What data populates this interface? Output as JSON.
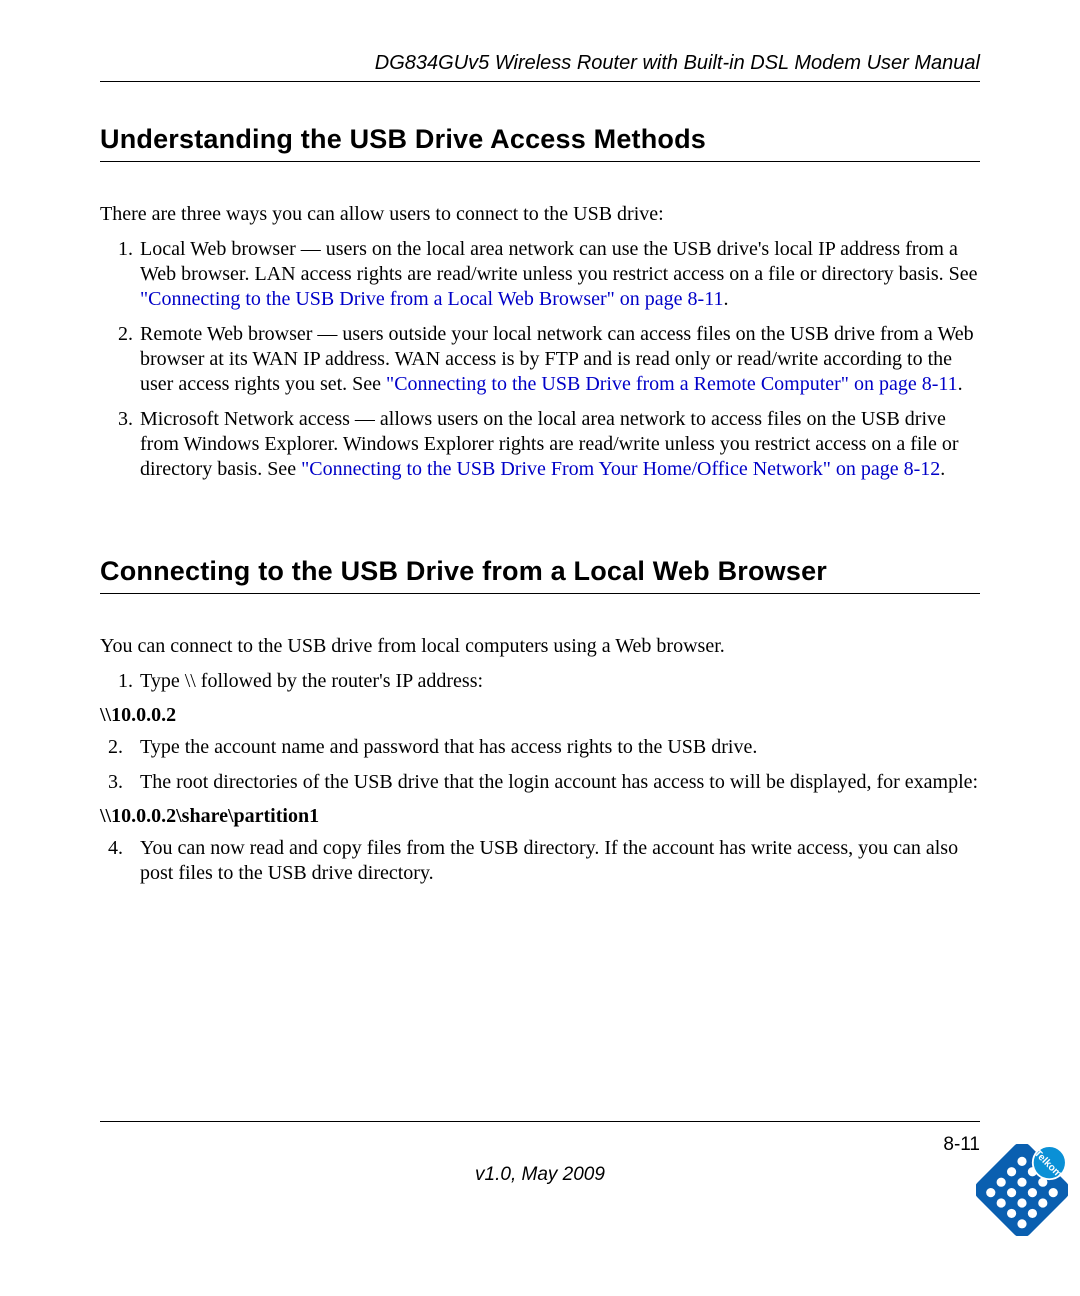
{
  "header": {
    "running_title": "DG834GUv5 Wireless Router with Built-in DSL Modem User Manual"
  },
  "section1": {
    "title": "Understanding the USB Drive Access Methods",
    "intro": "There are three ways you can allow users to connect to the USB drive:",
    "item1_a": "Local Web browser — users on the local area network can use the USB drive's local IP address from a Web browser. LAN access rights are read/write unless you restrict access on a file or directory basis. See ",
    "item1_link": "\"Connecting to the USB Drive from a Local Web Browser\" on page 8-11",
    "item1_b": ".",
    "item2_a": "Remote Web browser — users outside your local network can access files on the USB drive from a Web browser at its WAN IP address. WAN access is by FTP and is read only or read/write according to the user access rights you set. See ",
    "item2_link": "\"Connecting to the USB Drive from a Remote Computer\" on page 8-11",
    "item2_b": ".",
    "item3_a": "Microsoft Network access — allows users on the local area network to access files on the USB drive from Windows Explorer. Windows Explorer rights are read/write unless you restrict access on a file or directory basis. See ",
    "item3_link": "\"Connecting to the USB Drive From Your Home/Office Network\" on page 8-12",
    "item3_b": "."
  },
  "section2": {
    "title": "Connecting to the USB Drive from a Local Web Browser",
    "intro": "You can connect to the USB drive from local computers using a Web browser.",
    "step1": "Type \\\\ followed by the router's IP address:",
    "code1": "\\\\10.0.0.2",
    "step2": "Type the account name and password that has access rights to the USB drive.",
    "step3": "The root directories of the USB drive that the login account has access to will be displayed, for example:",
    "code2": "\\\\10.0.0.2\\share\\partition1",
    "step4": "You can now read and copy files from the USB directory. If the account has write access, you can also post files to the USB drive directory."
  },
  "footer": {
    "page": "8-11",
    "version": "v1.0, May 2009"
  },
  "logo": {
    "name": "Telkom"
  }
}
